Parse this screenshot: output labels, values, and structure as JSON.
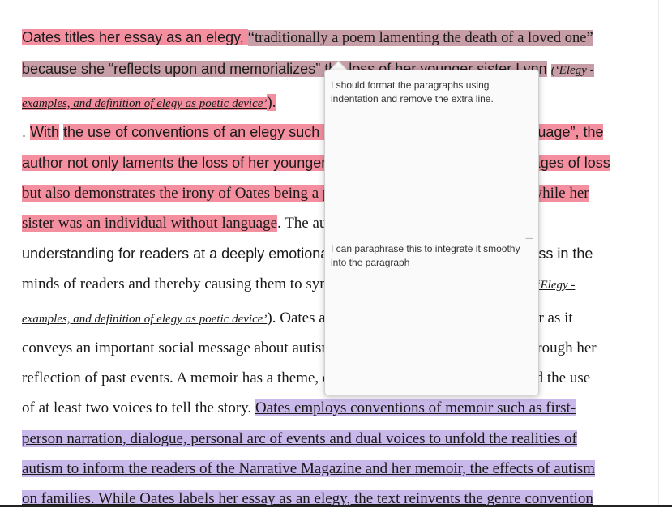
{
  "document": {
    "line1_a": "Oates titles her essay as an elegy, ",
    "line1_b": "“traditionally a poem lamenting the death of a loved one”",
    "line2_a": "because she “reflects upon and memorializes”",
    "line2_b": " the loss of her younger sister Lynn",
    "line2_cite": "(‘Elegy -",
    "line3_cite": "examples, and definition of elegy as poetic device’",
    "line3_end": ").",
    "line4_a": ". ",
    "line4_b": "With",
    "line4_c": " ",
    "line4_d": "the use of conventions of an elegy such as ",
    "line4_e": "“profoundly” and “graphic language”, the",
    "line5": "author not only laments the loss of her younger sister Lynn through the literal stages of loss",
    "line6": "but also demonstrates the irony of Oates being a prolific writer and communicator while her",
    "line7_a": "sister was an individual without language",
    "line7_b": ". The author constructs experience and",
    "line8": "understanding for readers at a deeply emotional level, evoking feelings of sadness in the",
    "line9_a": "minds of readers and thereby causing them to sympathize with people with autism",
    "line9_cite": "(‘Elegy -",
    "line10_cite": "examples, and definition of elegy as poetic device’",
    "line10_b": "). Oates also classifies her essay as a memoir as it",
    "line11": "conveys an important social message about autism and misogyny to the audience through her",
    "line12": "reflection of past events. A memoir has a theme, certain characteristics of fiction and the use",
    "line13_a": "of at least two voices to tell the story. ",
    "line13_b": "Oates employs conventions of memoir such as first-",
    "line14": "person narration, dialogue, personal arc of events and dual voices to unfold the realities of",
    "line15": "autism to inform the readers of the Narrative Magazine and her memoir, the effects of autism",
    "line16_a": "on families.",
    "line16_b": " While Oates labels her essay as an elegy, the text reinvents the genre convention"
  },
  "comments": [
    {
      "text": "I should format the paragraphs using indentation and remove the extra line."
    },
    {
      "text": "I can paraphrase this to integrate it smoothy into the paragraph"
    }
  ],
  "colors": {
    "highlight_pink": "#f48fa0",
    "highlight_mauve": "#c79ea7",
    "highlight_purple": "#c9b9ea"
  }
}
